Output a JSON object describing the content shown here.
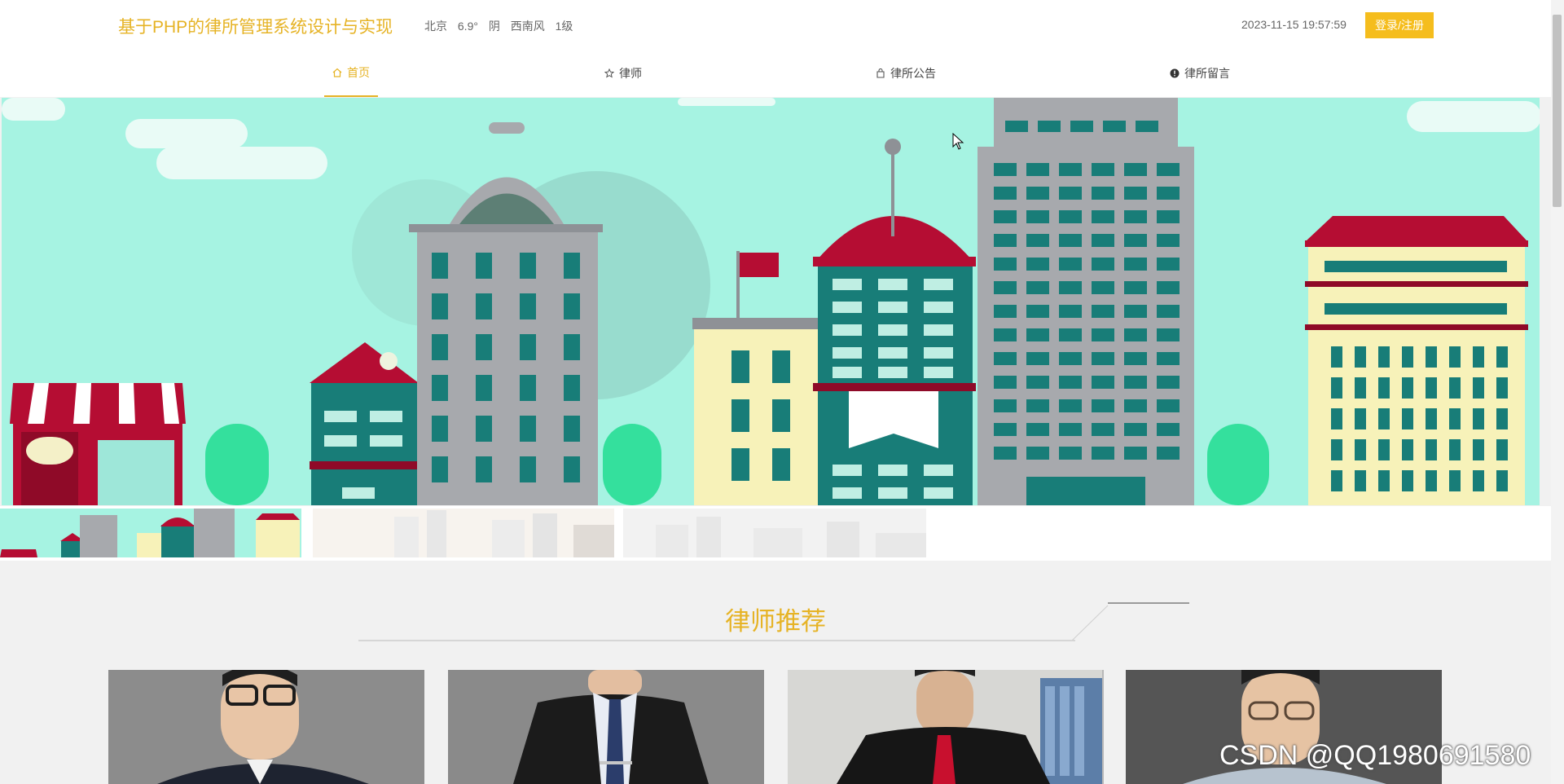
{
  "header": {
    "site_title": "基于PHP的律所管理系统设计与实现",
    "weather": {
      "city": "北京",
      "temperature": "6.9°",
      "condition": "阴",
      "wind_direction": "西南风",
      "wind_level": "1级"
    },
    "datetime": "2023-11-15 19:57:59",
    "login_label": "登录/注册"
  },
  "nav": {
    "items": [
      {
        "label": "首页",
        "icon": "home-icon",
        "active": true
      },
      {
        "label": "律师",
        "icon": "star-icon",
        "active": false
      },
      {
        "label": "律所公告",
        "icon": "bag-icon",
        "active": false
      },
      {
        "label": "律所留言",
        "icon": "info-icon",
        "active": false
      }
    ]
  },
  "banner": {
    "slide_count": 3,
    "active_slide": 1
  },
  "recommend": {
    "title": "律师推荐"
  },
  "watermark": "CSDN @QQ1980691580",
  "colors": {
    "accent": "#e6b325",
    "button": "#f5bd1d",
    "banner_sky": "#a6f3e2",
    "building_red": "#b50d33",
    "building_teal": "#187d78"
  }
}
